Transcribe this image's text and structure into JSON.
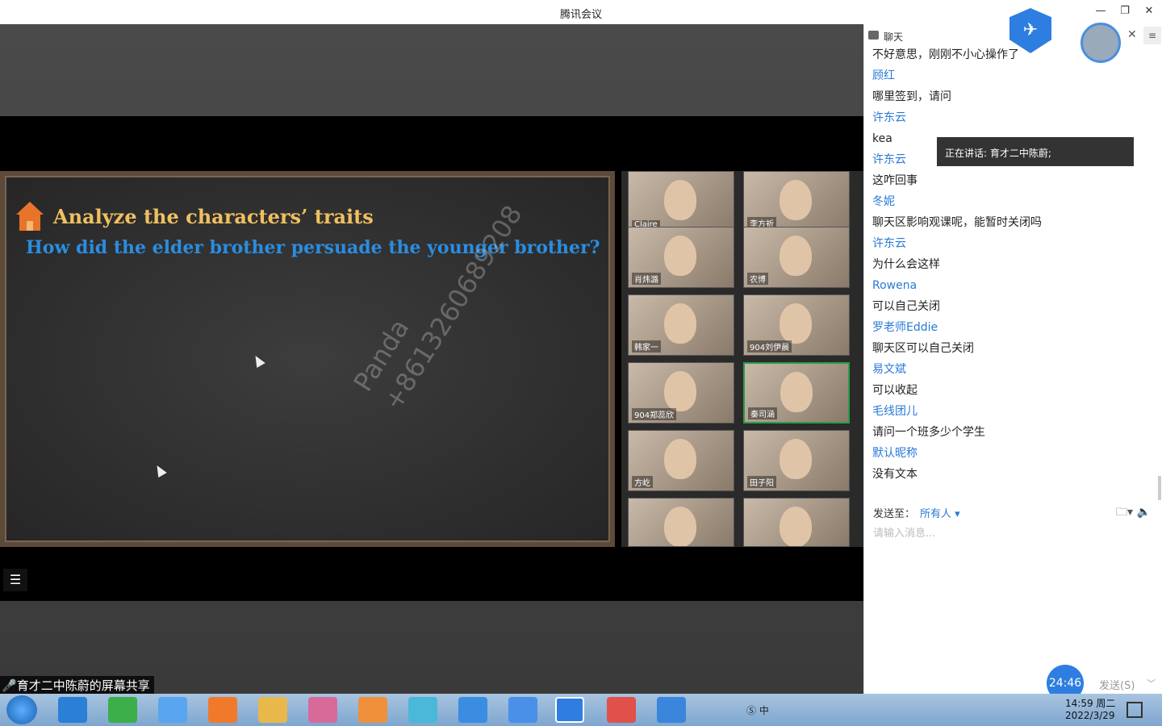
{
  "window": {
    "title": "腾讯会议"
  },
  "slide": {
    "heading": "Analyze the characters’ traits",
    "question": "How did the elder brother persuade the younger brother?",
    "watermark_name": "Panda",
    "watermark_phone": "+8613260689208"
  },
  "participants": [
    {
      "name": "Claire"
    },
    {
      "name": "李方祈"
    },
    {
      "name": "肖炜潞"
    },
    {
      "name": "农博"
    },
    {
      "name": "韩家一"
    },
    {
      "name": "904刘伊晨"
    },
    {
      "name": "904郑蕊欣"
    },
    {
      "name": "秦司涵"
    },
    {
      "name": "方屹"
    },
    {
      "name": "田子阳"
    },
    {
      "name": ""
    },
    {
      "name": ""
    }
  ],
  "share_label": "育才二中陈蔚的屏幕共享",
  "chat": {
    "title": "聊天",
    "messages": [
      {
        "type": "body",
        "text": "不好意思，刚刚不小心操作了"
      },
      {
        "type": "sender",
        "text": "顾红"
      },
      {
        "type": "body",
        "text": "哪里签到，请问"
      },
      {
        "type": "sender",
        "text": "许东云"
      },
      {
        "type": "body",
        "text": "kea"
      },
      {
        "type": "sender",
        "text": "许东云"
      },
      {
        "type": "body",
        "text": "这咋回事"
      },
      {
        "type": "sender",
        "text": "冬妮"
      },
      {
        "type": "body",
        "text": "聊天区影响观课呢，能暂时关闭吗"
      },
      {
        "type": "sender",
        "text": "许东云"
      },
      {
        "type": "body",
        "text": "为什么会这样"
      },
      {
        "type": "sender",
        "text": "Rowena"
      },
      {
        "type": "body",
        "text": "可以自己关闭"
      },
      {
        "type": "sender",
        "text": "罗老师Eddie"
      },
      {
        "type": "body",
        "text": "聊天区可以自己关闭"
      },
      {
        "type": "sender",
        "text": "易文斌"
      },
      {
        "type": "body",
        "text": "可以收起"
      },
      {
        "type": "sender",
        "text": "毛线团儿"
      },
      {
        "type": "body",
        "text": "请问一个班多少个学生"
      },
      {
        "type": "sender",
        "text": "默认昵称"
      },
      {
        "type": "body",
        "text": "没有文本"
      }
    ],
    "speaking": "正在讲话: 育才二中陈蔚;",
    "send_to_label": "发送至：",
    "send_to_target": "所有人 ▾",
    "input_placeholder": "请输入消息...",
    "timer": "24:46",
    "send_button": "发送(S)"
  },
  "taskbar": {
    "ime": "中",
    "time": "14:59 周二",
    "date": "2022/3/29"
  }
}
